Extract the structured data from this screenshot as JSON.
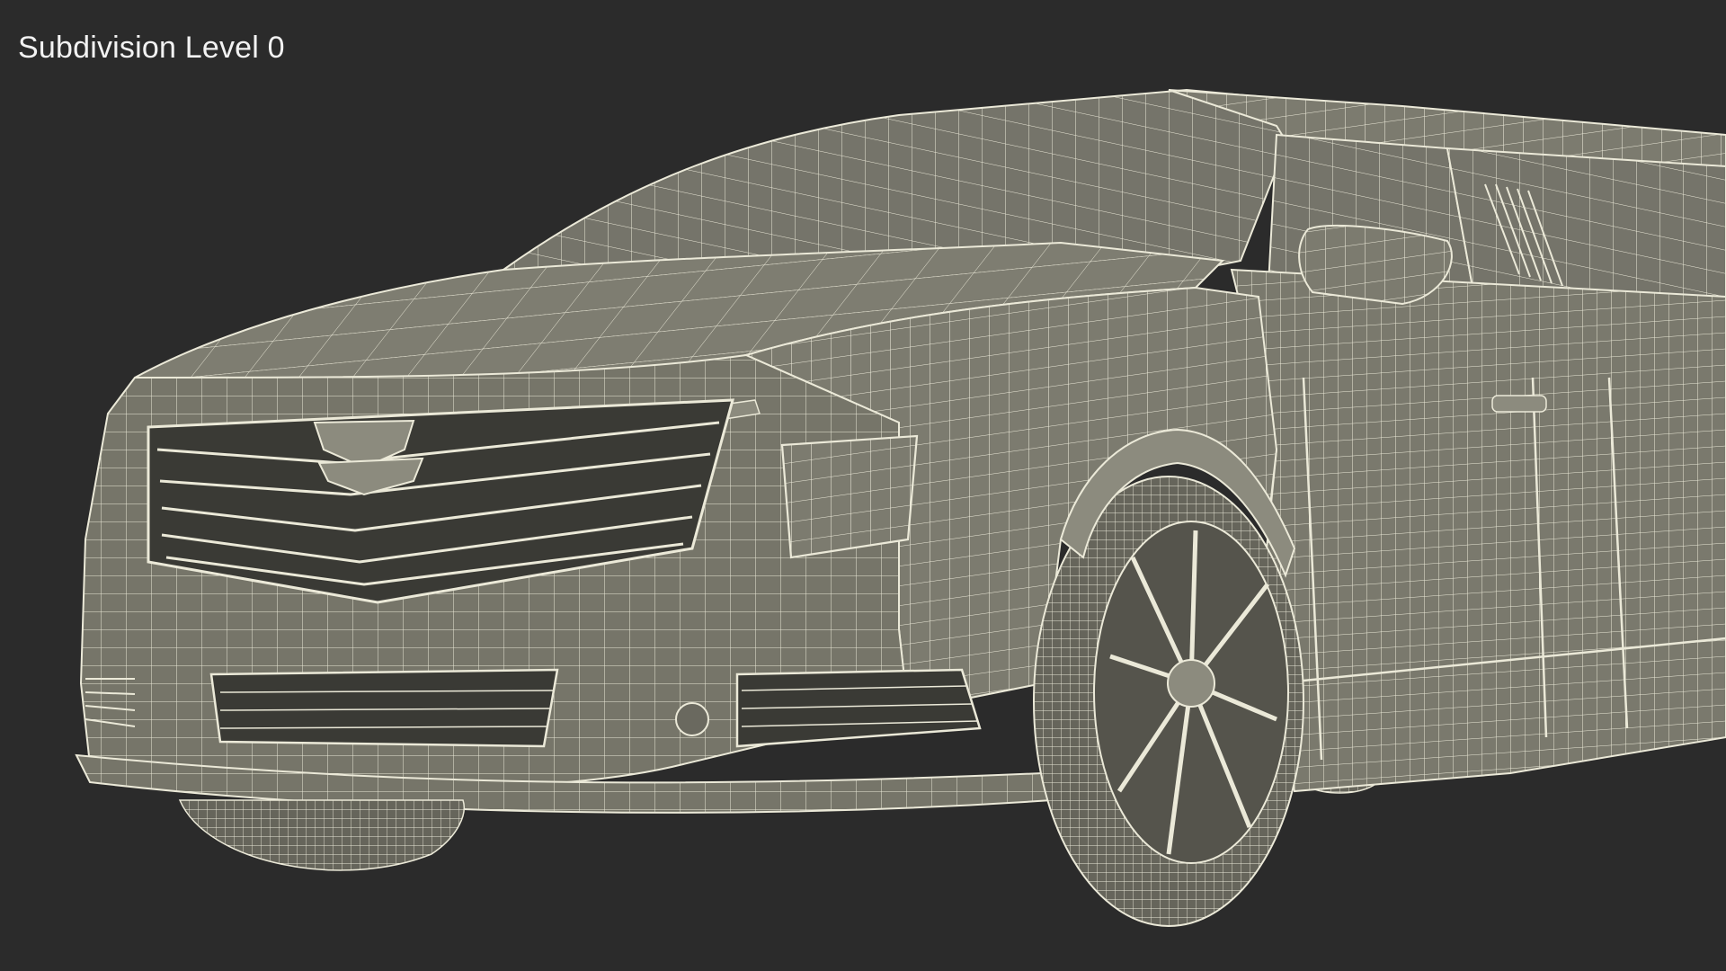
{
  "viewport": {
    "label": "Subdivision Level 0"
  },
  "colors": {
    "background": "#2b2b2b",
    "surface": "#7c7b6f",
    "surface_light": "#8c8b7e",
    "surface_dark": "#55544c",
    "opening": "#3a3a35",
    "wire": "#ebe9d8"
  },
  "scene": {
    "subject": "limousine-wireframe-model",
    "shading": "wireframe-on-shaded"
  }
}
